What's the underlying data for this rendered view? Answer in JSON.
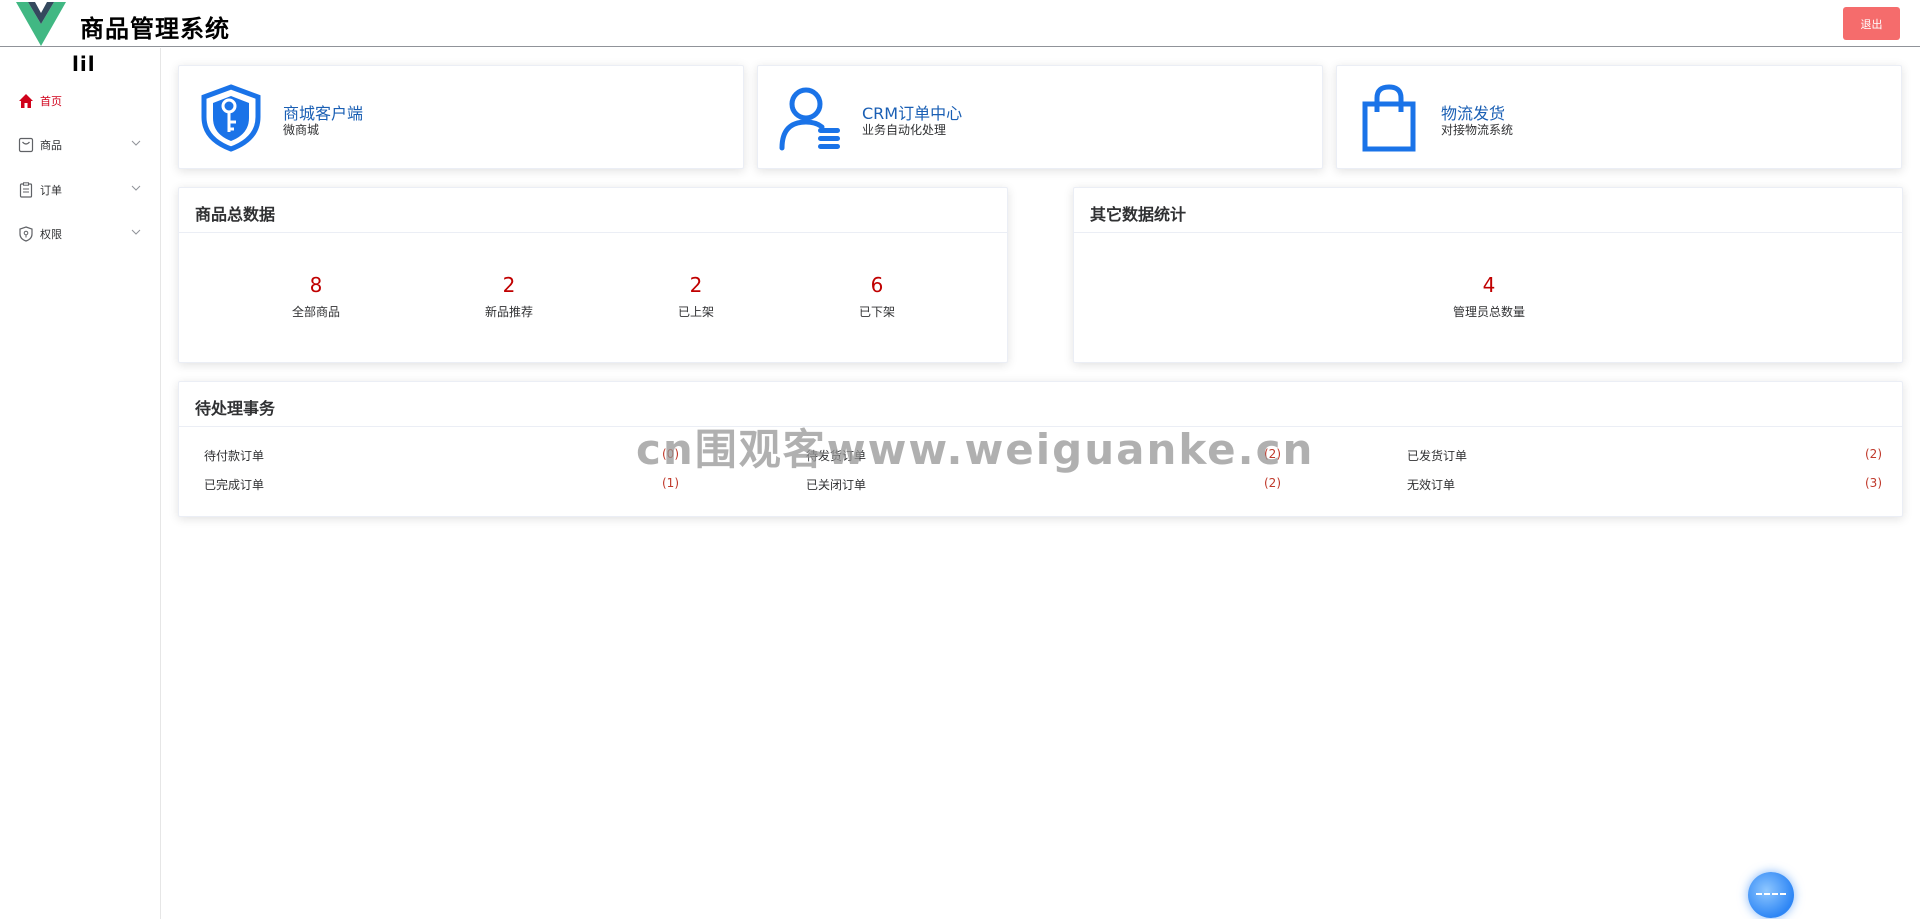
{
  "header": {
    "title": "商品管理系统",
    "logout_label": "退出"
  },
  "sidebar": {
    "toggle_label": "lil",
    "items": [
      {
        "label": "首页",
        "icon": "home-icon",
        "active": true
      },
      {
        "label": "商品",
        "icon": "goods-icon",
        "active": false
      },
      {
        "label": "订单",
        "icon": "order-icon",
        "active": false
      },
      {
        "label": "权限",
        "icon": "permission-icon",
        "active": false
      }
    ]
  },
  "quick_links": [
    {
      "title": "商城客户端",
      "subtitle": "微商城",
      "icon": "shield-key-icon"
    },
    {
      "title": "CRM订单中心",
      "subtitle": "业务自动化处理",
      "icon": "user-list-icon"
    },
    {
      "title": "物流发货",
      "subtitle": "对接物流系统",
      "icon": "shopping-bag-icon"
    }
  ],
  "goods_panel": {
    "title": "商品总数据",
    "stats": [
      {
        "value": "8",
        "label": "全部商品"
      },
      {
        "value": "2",
        "label": "新品推荐"
      },
      {
        "value": "2",
        "label": "已上架"
      },
      {
        "value": "6",
        "label": "已下架"
      }
    ]
  },
  "other_panel": {
    "title": "其它数据统计",
    "stats": [
      {
        "value": "4",
        "label": "管理员总数量"
      }
    ]
  },
  "todo_panel": {
    "title": "待处理事务",
    "items": [
      {
        "label": "待付款订单",
        "count": "(0)"
      },
      {
        "label": "待发货订单",
        "count": "(2)"
      },
      {
        "label": "已发货订单",
        "count": "(2)"
      },
      {
        "label": "已完成订单",
        "count": "(1)"
      },
      {
        "label": "已关闭订单",
        "count": "(2)"
      },
      {
        "label": "无效订单",
        "count": "(3)"
      }
    ]
  },
  "watermark": "cn围观客www.weiguanke.cn",
  "colors": {
    "accent": "#1a5fb4",
    "danger": "#f56c6c",
    "stat_number": "#c00000",
    "active_menu": "#d0021b"
  }
}
